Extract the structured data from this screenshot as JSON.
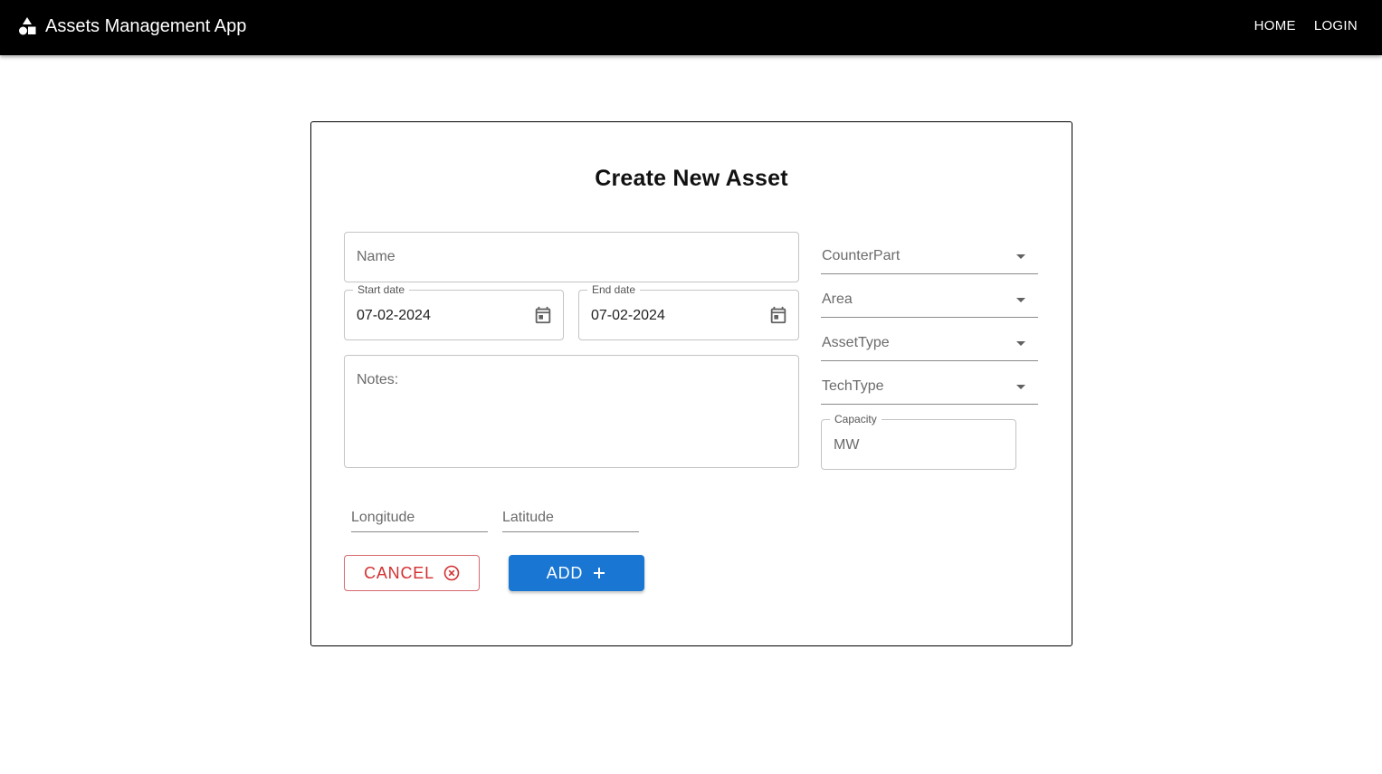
{
  "appbar": {
    "title": "Assets Management App",
    "nav": [
      "HOME",
      "LOGIN"
    ]
  },
  "form": {
    "title": "Create New Asset",
    "name_placeholder": "Name",
    "start_date": {
      "label": "Start date",
      "value": "07-02-2024"
    },
    "end_date": {
      "label": "End date",
      "value": "07-02-2024"
    },
    "notes_placeholder": "Notes:",
    "selects": [
      "CounterPart",
      "Area",
      "AssetType",
      "TechType"
    ],
    "capacity": {
      "label": "Capacity",
      "placeholder": "MW"
    },
    "longitude_placeholder": "Longitude",
    "latitude_placeholder": "Latitude",
    "cancel_label": "CANCEL",
    "add_label": "ADD"
  },
  "colors": {
    "appbar_bg": "#000000",
    "primary": "#1976d2",
    "error": "#d32f2f"
  },
  "icons": [
    "shapes-logo-icon",
    "calendar-icon",
    "cancel-circle-icon",
    "plus-icon",
    "dropdown-caret-icon"
  ]
}
